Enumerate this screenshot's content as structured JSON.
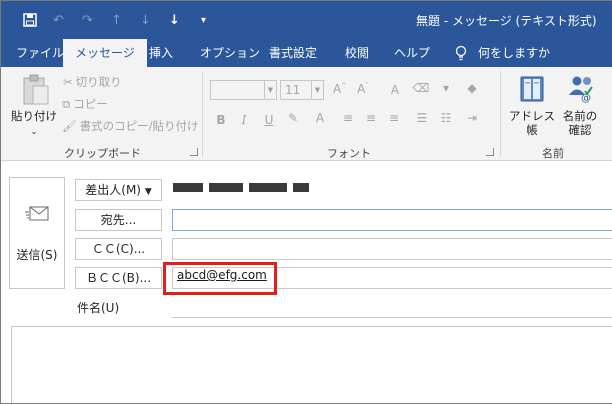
{
  "window": {
    "title": "無題 - メッセージ (テキスト形式)"
  },
  "qat": {
    "icons": [
      "save-icon",
      "undo-icon",
      "redo-icon",
      "up-arrow-icon",
      "down-arrow-icon",
      "down-arrow-bold-icon",
      "customize-icon"
    ]
  },
  "tabs": [
    {
      "label": "ファイル",
      "active": false
    },
    {
      "label": "メッセージ",
      "active": true
    },
    {
      "label": "挿入",
      "active": false
    },
    {
      "label": "オプション",
      "active": false
    },
    {
      "label": "書式設定",
      "active": false
    },
    {
      "label": "校閲",
      "active": false
    },
    {
      "label": "ヘルプ",
      "active": false
    }
  ],
  "tell_me": "何をしますか",
  "ribbon": {
    "clipboard": {
      "paste": "貼り付け",
      "cut": "切り取り",
      "copy": "コピー",
      "format_painter": "書式のコピー/貼り付け",
      "group_label": "クリップボード"
    },
    "font": {
      "font_name": "",
      "font_size": "11",
      "bold": "B",
      "italic": "I",
      "underline": "U",
      "group_label": "フォント"
    },
    "names": {
      "address_book": "アドレス帳",
      "check_names_line1": "名前の",
      "check_names_line2": "確認",
      "group_label": "名前"
    }
  },
  "compose": {
    "send_label": "送信(S)",
    "from_label": "差出人(M)",
    "to_label": "宛先...",
    "cc_label": "ＣＣ(C)...",
    "bcc_label": "ＢＣＣ(B)...",
    "subject_label": "件名(U)",
    "bcc_value": "abcd@efg.com"
  },
  "colors": {
    "accent": "#2b579a",
    "highlight": "#e0201b",
    "ribbon_bg": "#f3f3f3"
  }
}
